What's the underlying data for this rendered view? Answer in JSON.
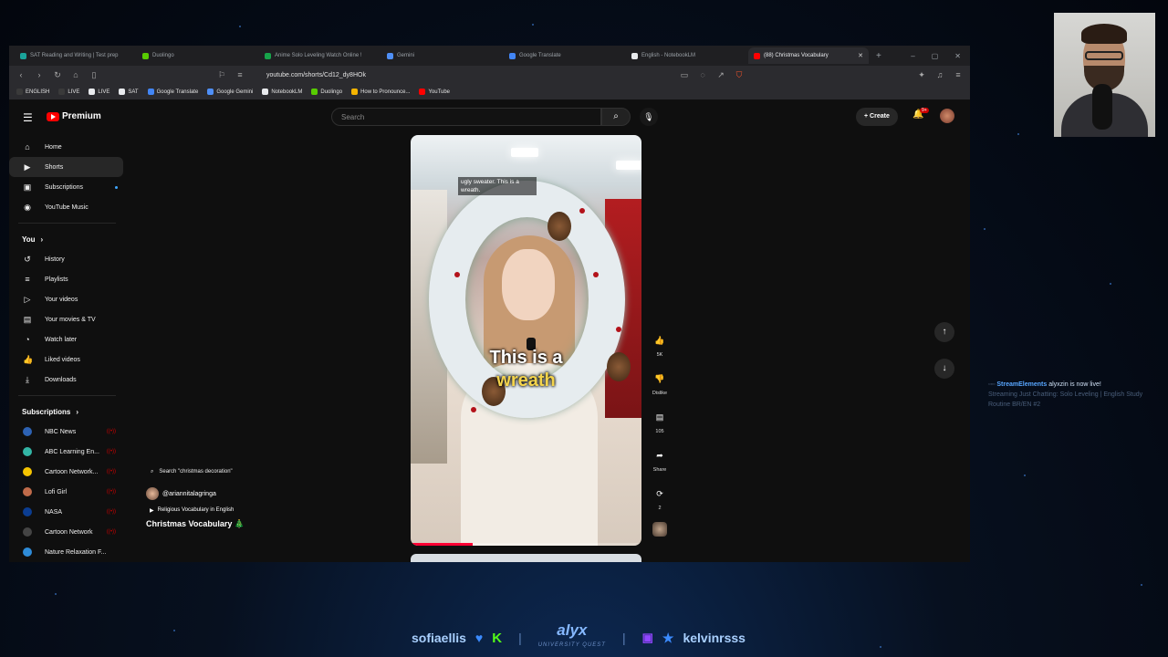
{
  "browser": {
    "tabs": [
      {
        "label": "SAT Reading and Writing | Test prep",
        "color": "#1aa39a"
      },
      {
        "label": "Duolingo",
        "color": "#58cc02"
      },
      {
        "label": "Anime Solo Leveling Watch Online !",
        "color": "#17a34a"
      },
      {
        "label": "Gemini",
        "color": "#4f8ff7"
      },
      {
        "label": "Google Translate",
        "color": "#4285f4"
      },
      {
        "label": "English - NotebookLM",
        "color": "#e8eaed"
      },
      {
        "label": "(88) Christmas Vocabulary",
        "color": "#ff0000",
        "active": true
      }
    ],
    "url": "youtube.com/shorts/Cd12_dy8HOk",
    "bookmarks": [
      {
        "label": "ENGLISH",
        "color": "#3a3a3a"
      },
      {
        "label": "LIVE",
        "color": "#3a3a3a"
      },
      {
        "label": "LIVE",
        "color": "#e8eaed"
      },
      {
        "label": "SAT",
        "color": "#e8eaed"
      },
      {
        "label": "Google Translate",
        "color": "#4285f4"
      },
      {
        "label": "Google Gemini",
        "color": "#4f8ff7"
      },
      {
        "label": "NotebookLM",
        "color": "#e8eaed"
      },
      {
        "label": "Duolingo",
        "color": "#58cc02"
      },
      {
        "label": "How to Pronounce...",
        "color": "#f4b400"
      },
      {
        "label": "YouTube",
        "color": "#ff0000"
      }
    ]
  },
  "youtube": {
    "logo_label": "Premium",
    "search_placeholder": "Search",
    "create_label": "Create",
    "notification_count": "9+",
    "sidebar": {
      "main": [
        {
          "label": "Home",
          "icon": "home-icon"
        },
        {
          "label": "Shorts",
          "icon": "shorts-icon",
          "active": true
        },
        {
          "label": "Subscriptions",
          "icon": "subscriptions-icon",
          "dot": true
        },
        {
          "label": "YouTube Music",
          "icon": "music-icon"
        }
      ],
      "you_label": "You",
      "you": [
        {
          "label": "History",
          "icon": "history-icon"
        },
        {
          "label": "Playlists",
          "icon": "playlists-icon"
        },
        {
          "label": "Your videos",
          "icon": "your-videos-icon"
        },
        {
          "label": "Your movies & TV",
          "icon": "movies-icon"
        },
        {
          "label": "Watch later",
          "icon": "clock-icon"
        },
        {
          "label": "Liked videos",
          "icon": "thumb-up-icon"
        },
        {
          "label": "Downloads",
          "icon": "download-icon"
        }
      ],
      "subscriptions_label": "Subscriptions",
      "subscriptions": [
        {
          "label": "NBC News",
          "color": "#2d62b3"
        },
        {
          "label": "ABC Learning En...",
          "color": "#33b5a5"
        },
        {
          "label": "Cartoon Network...",
          "color": "#f5c400"
        },
        {
          "label": "Lofi Girl",
          "color": "#c06b4a"
        },
        {
          "label": "NASA",
          "color": "#0b3d91"
        },
        {
          "label": "Cartoon Network",
          "color": "#444444"
        },
        {
          "label": "Nature Relaxation F...",
          "color": "#2e8bd8"
        }
      ]
    },
    "short": {
      "search_chip": "Search \"christmas decoration\"",
      "channel": "@ariannitalagringa",
      "playlist": "Religious Vocabulary in English",
      "title": "Christmas Vocabulary 🎄",
      "caption_small": "ugly sweater. This is a wreath.",
      "caption_line1": "This is a",
      "caption_line2": "wreath",
      "progress": 0.27,
      "likes": "5K",
      "dislike_label": "Dislike",
      "comments": "105",
      "share_label": "Share",
      "remix_count": "2"
    }
  },
  "overlay": {
    "alert_app": "StreamElements",
    "alert_text": "alyxzin is now live!",
    "alert_detail": "Streaming Just Chatting: Solo Leveling | English Study Routine BR/EN #2",
    "footer_left": "sofiaellis",
    "footer_logo": "alyx",
    "footer_logo_sub": "UNIVERSITY QUEST",
    "footer_right": "kelvinrsss"
  }
}
